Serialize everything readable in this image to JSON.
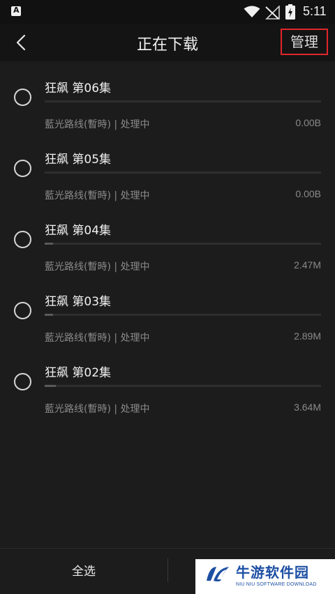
{
  "status_bar": {
    "time": "5:11"
  },
  "header": {
    "title": "正在下载",
    "manage_label": "管理"
  },
  "downloads": [
    {
      "title": "狂飙 第06集",
      "source": "藍光路线(暫時) | 处理中",
      "size": "0.00B",
      "progress": 0.0
    },
    {
      "title": "狂飙 第05集",
      "source": "藍光路线(暫時) | 处理中",
      "size": "0.00B",
      "progress": 0.0
    },
    {
      "title": "狂飙 第04集",
      "source": "藍光路线(暫時) | 处理中",
      "size": "2.47M",
      "progress": 0.03
    },
    {
      "title": "狂飙 第03集",
      "source": "藍光路线(暫時) | 处理中",
      "size": "2.89M",
      "progress": 0.03
    },
    {
      "title": "狂飙 第02集",
      "source": "藍光路线(暫時) | 处理中",
      "size": "3.64M",
      "progress": 0.04
    }
  ],
  "bottom_bar": {
    "select_all_label": "全选"
  },
  "watermark": {
    "brand": "牛游软件园",
    "tagline": "NIU NIU SOFTWARE DOWNLOAD"
  },
  "colors": {
    "background": "#1c1c1c",
    "highlight_box": "#e0262c",
    "watermark_blue": "#1d4fa3"
  }
}
